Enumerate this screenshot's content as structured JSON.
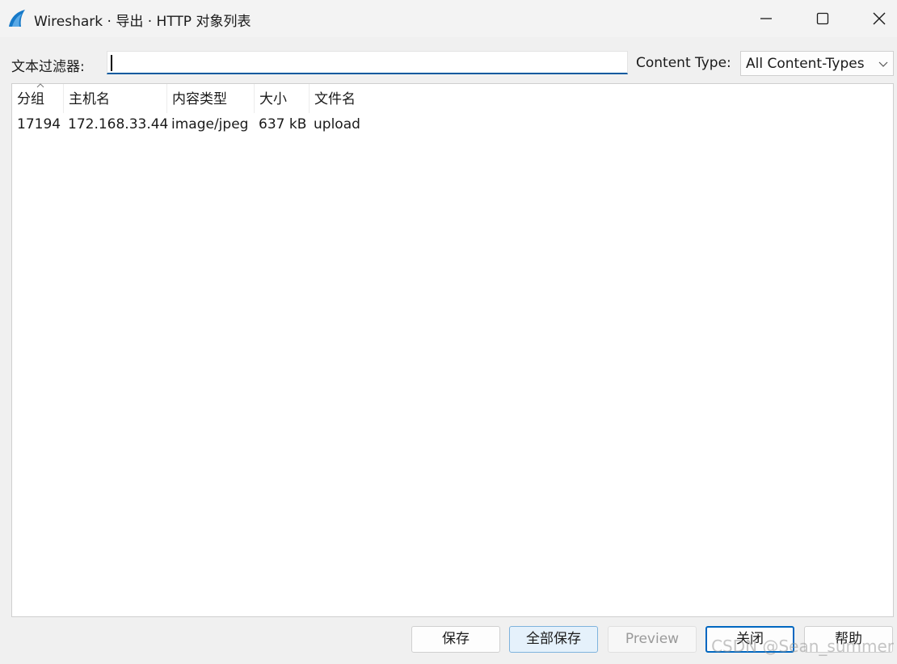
{
  "window": {
    "title": "Wireshark · 导出 · HTTP 对象列表",
    "icon": "wireshark-fin-icon"
  },
  "filter": {
    "label": "文本过滤器:",
    "value": ""
  },
  "content_type": {
    "label": "Content Type:",
    "selected": "All Content-Types"
  },
  "table": {
    "columns": [
      "分组",
      "主机名",
      "内容类型",
      "大小",
      "文件名"
    ],
    "rows": [
      [
        "17194",
        "172.168.33.44",
        "image/jpeg",
        "637 kB",
        "upload"
      ]
    ]
  },
  "buttons": {
    "save": "保存",
    "save_all": "全部保存",
    "preview": "Preview",
    "close": "关闭",
    "help": "帮助"
  },
  "watermark": "CSDN @Sean_summer",
  "colors": {
    "accent": "#005a9e",
    "wireshark_blue": "#1679c8"
  }
}
